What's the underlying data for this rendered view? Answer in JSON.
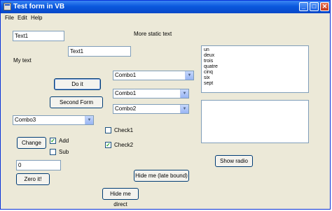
{
  "window": {
    "title": "Test form in VB",
    "min_glyph": "_",
    "max_glyph": "□",
    "close_glyph": "✕"
  },
  "menu": [
    "File",
    "Edit",
    "Help"
  ],
  "textboxes": {
    "text1a": "Text1",
    "text1b": "Text1",
    "zero_value": "0"
  },
  "labels": {
    "more_static": "More static text",
    "my_text": "My text"
  },
  "buttons": {
    "do_it": "Do it",
    "second_form": "Second Form",
    "change": "Change",
    "zero_it": "Zero it!",
    "hide_late": "Hide me (late bound)",
    "hide_direct": "Hide me direct",
    "show_radio": "Show radio"
  },
  "combos": {
    "combo1_a": "Combo1",
    "combo1_b": "Combo1",
    "combo2": "Combo2",
    "combo3": "Combo3"
  },
  "checkboxes": {
    "check1": {
      "label": "Check1",
      "checked": false
    },
    "check2": {
      "label": "Check2",
      "checked": true
    },
    "add": {
      "label": "Add",
      "checked": true
    },
    "sub": {
      "label": "Sub",
      "checked": false
    }
  },
  "listbox": {
    "items": [
      "un",
      "deux",
      "trois",
      "quatre",
      "cinq",
      "six",
      "sept"
    ]
  },
  "colors": {
    "title_bar": "#0a58dd",
    "window_bg": "#ece9d8",
    "check_mark": "#21a121"
  }
}
